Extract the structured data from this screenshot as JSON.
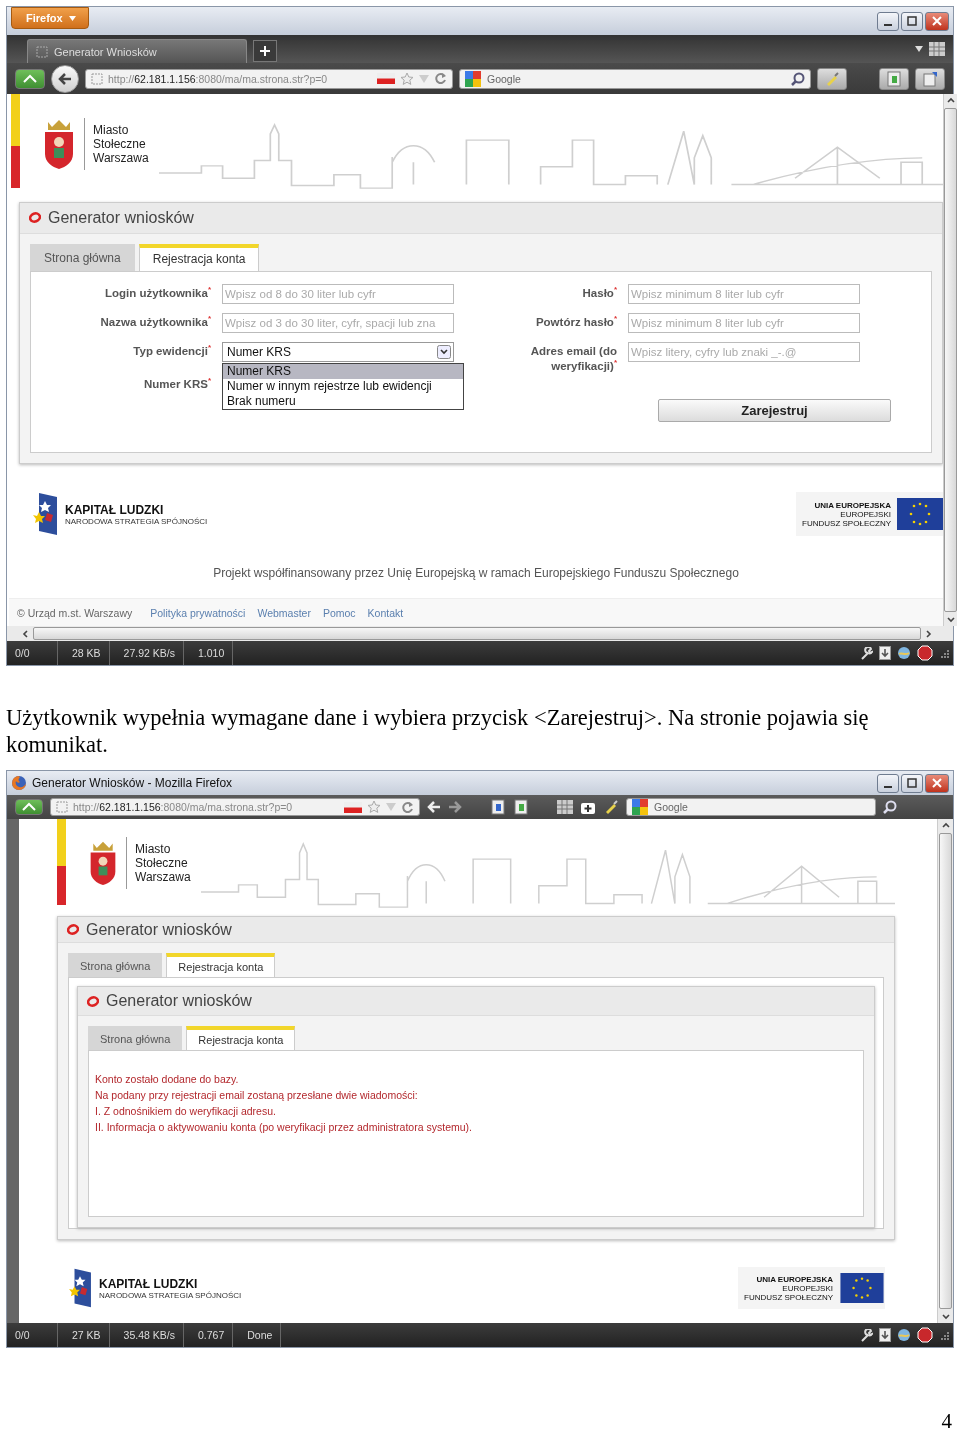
{
  "shot1": {
    "window": {
      "menu_button": "Firefox"
    },
    "tab": {
      "title": "Generator Wniosków"
    },
    "address": {
      "scheme": "http://",
      "host": "62.181.1.156",
      "path": ":8080/ma/ma.strona.str?p=0"
    },
    "search": {
      "placeholder": "Google"
    },
    "page": {
      "city": [
        "Miasto",
        "Stołeczne",
        "Warszawa"
      ],
      "app_title": "Generator wniosków",
      "tabs": [
        {
          "label": "Strona główna",
          "selected": false
        },
        {
          "label": "Rejestracja konta",
          "selected": true
        }
      ],
      "left_fields": [
        {
          "label": "Login użytkownika",
          "mark": "*",
          "kind": "input",
          "placeholder": "Wpisz od 8 do 30 liter lub cyfr"
        },
        {
          "label": "Nazwa użytkownika",
          "mark": "*",
          "kind": "input",
          "placeholder": "Wpisz od 3 do 30 liter, cyfr, spacji lub zna"
        },
        {
          "label": "Typ ewidencji",
          "mark": "*",
          "kind": "select",
          "value": "Numer KRS",
          "expanded": true,
          "options": [
            {
              "label": "Numer KRS",
              "selected": true
            },
            {
              "label": "Numer w innym rejestrze lub ewidencji",
              "selected": false
            },
            {
              "label": "Brak numeru",
              "selected": false
            }
          ]
        },
        {
          "label": "Numer KRS",
          "mark": "*",
          "kind": "covered"
        }
      ],
      "right_fields": [
        {
          "label": "Hasło",
          "mark": "*",
          "kind": "input",
          "placeholder": "Wpisz minimum 8 liter lub cyfr"
        },
        {
          "label": "Powtórz hasło",
          "mark": "*",
          "kind": "input",
          "placeholder": "Wpisz minimum 8 liter lub cyfr"
        },
        {
          "label": "Adres email (do weryfikacji)",
          "mark": "*",
          "kind": "input",
          "placeholder": "Wpisz litery, cyfry lub znaki _-.@"
        }
      ],
      "submit": "Zarejestruj",
      "logos": {
        "kl_title": "KAPITAŁ LUDZKI",
        "kl_subtitle": "NARODOWA STRATEGIA SPÓJNOŚCI",
        "eu_lines": [
          "UNIA EUROPEJSKA",
          "EUROPEJSKI",
          "FUNDUSZ SPOŁECZNY"
        ]
      },
      "project_note": "Projekt współfinansowany przez Unię Europejską w ramach Europejskiego Funduszu Społecznego",
      "footer": {
        "copyright": "© Urząd m.st. Warszawy",
        "links": [
          "Polityka prywatności",
          "Webmaster",
          "Pomoc",
          "Kontakt"
        ]
      }
    },
    "status": [
      "0/0",
      "28 KB",
      "27.92 KB/s",
      "1.010"
    ]
  },
  "caption": "Użytkownik wypełnia wymagane dane i wybiera przycisk <Zarejestruj>. Na stronie pojawia się komunikat.",
  "shot2": {
    "window": {
      "title": "Generator Wniosków - Mozilla Firefox"
    },
    "address": {
      "scheme": "http://",
      "host": "62.181.1.156",
      "path": ":8080/ma/ma.strona.str?p=0"
    },
    "search": {
      "placeholder": "Google"
    },
    "page": {
      "city": [
        "Miasto",
        "Stołeczne",
        "Warszawa"
      ],
      "outer": {
        "app_title": "Generator wniosków",
        "tabs": [
          {
            "label": "Strona główna",
            "selected": false
          },
          {
            "label": "Rejestracja konta",
            "selected": true
          }
        ]
      },
      "inner": {
        "app_title": "Generator wniosków",
        "tabs": [
          {
            "label": "Strona główna",
            "selected": false
          },
          {
            "label": "Rejestracja konta",
            "selected": true
          }
        ],
        "messages": [
          "Konto zostało dodane do bazy.",
          "Na podany przy rejestracji email zostaną przesłane dwie wiadomości:",
          "I. Z odnośnikiem do weryfikacji adresu.",
          "II. Informacja o aktywowaniu konta (po weryfikacji przez administratora systemu)."
        ]
      },
      "logos": {
        "kl_title": "KAPITAŁ LUDZKI",
        "kl_subtitle": "NARODOWA STRATEGIA SPÓJNOŚCI",
        "eu_lines": [
          "UNIA EUROPEJSKA",
          "EUROPEJSKI",
          "FUNDUSZ SPOŁECZNY"
        ]
      }
    },
    "status": [
      "0/0",
      "27 KB",
      "35.48 KB/s",
      "0.767",
      "Done"
    ]
  },
  "page_number": "4"
}
